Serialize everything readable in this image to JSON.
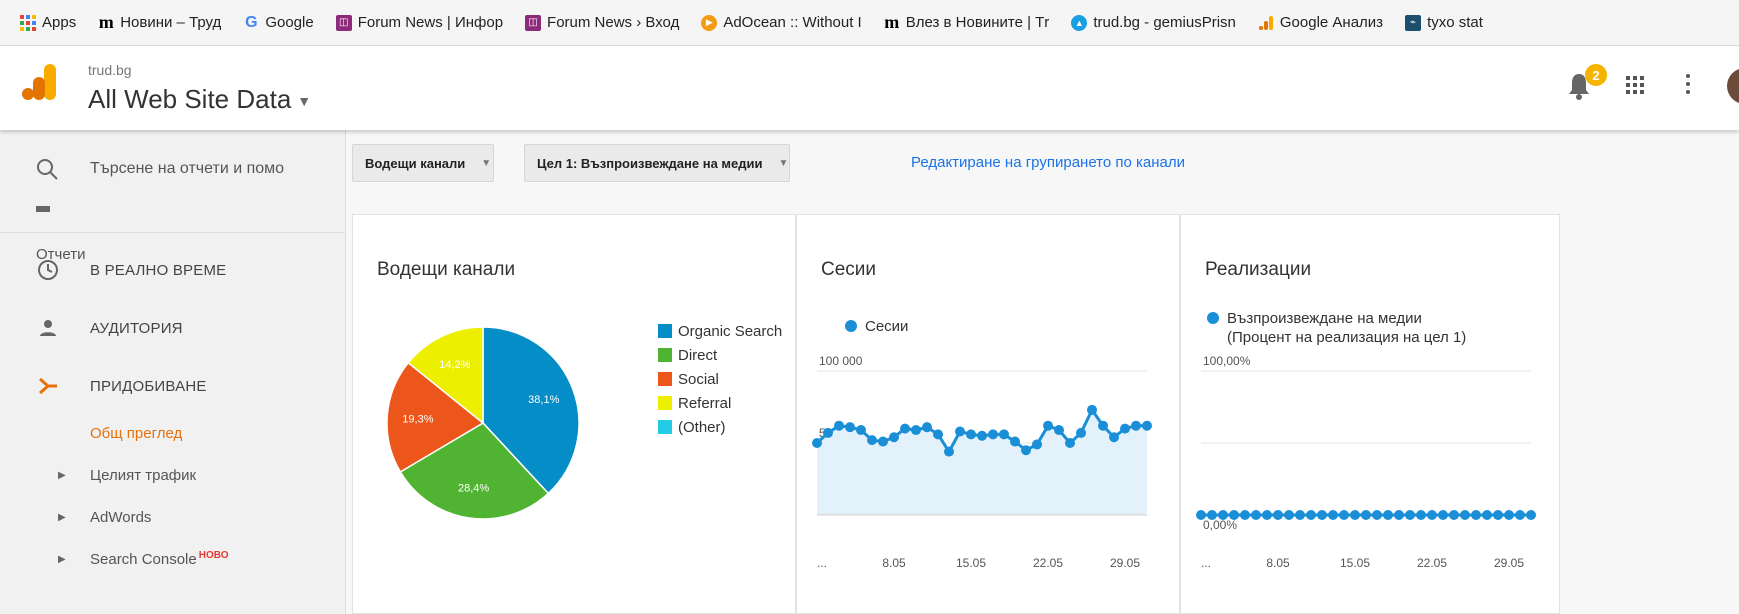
{
  "bookmarks": [
    {
      "label": "Apps",
      "icon": "apps-grid-icon"
    },
    {
      "label": "Новини – Труд",
      "icon": "m-logo-icon"
    },
    {
      "label": "Google",
      "icon": "google-icon"
    },
    {
      "label": "Forum News | Инфор",
      "icon": "forum-news-icon"
    },
    {
      "label": "Forum News › Вход",
      "icon": "forum-news-icon"
    },
    {
      "label": "AdOcean :: Without I",
      "icon": "adocean-icon"
    },
    {
      "label": "Влез в Новините | Тr",
      "icon": "m-logo-icon"
    },
    {
      "label": "trud.bg - gemiusPrisn",
      "icon": "trud-icon"
    },
    {
      "label": "Google Анализ",
      "icon": "google-analytics-icon"
    },
    {
      "label": "tyxo stat",
      "icon": "tyxo-icon"
    }
  ],
  "header": {
    "account": "trud.bg",
    "property": "All Web Site Data",
    "notifications_count": "2"
  },
  "sidebar": {
    "search_placeholder": "Търсене на отчети и помо",
    "reports_label": "Отчети",
    "items": [
      {
        "label": "В РЕАЛНО ВРЕМЕ",
        "icon": "clock-icon"
      },
      {
        "label": "АУДИТОРИЯ",
        "icon": "person-icon"
      },
      {
        "label": "ПРИДОБИВАНЕ",
        "icon": "acquisition-icon"
      }
    ],
    "subitems": [
      {
        "label": "Общ преглед",
        "active": true
      },
      {
        "label": "Целият трафик"
      },
      {
        "label": "AdWords"
      },
      {
        "label": "Search Console",
        "badge": "НОВО"
      }
    ]
  },
  "toolbar": {
    "dropdown1": "Водещи канали",
    "dropdown2": "Цел 1: Възпроизвеждане на медии",
    "edit_link": "Редактиране на групирането по канали"
  },
  "colors": {
    "accent": "#e8710a",
    "link": "#1a73e8",
    "series": "#1a8fd8"
  },
  "panels": {
    "channels": {
      "title": "Водещи канали"
    },
    "sessions": {
      "title": "Сесии",
      "legend": "Сесии"
    },
    "conversions": {
      "title": "Реализации",
      "legend_line1": "Възпроизвеждане на медии",
      "legend_line2": "(Процент на реализация на цел 1)"
    }
  },
  "chart_data": [
    {
      "type": "pie",
      "title": "Водещи канали",
      "slices": [
        {
          "name": "Organic Search",
          "value": 38.1,
          "label": "38,1%",
          "color": "#058dc7"
        },
        {
          "name": "Direct",
          "value": 28.4,
          "label": "28,4%",
          "color": "#50b432"
        },
        {
          "name": "Social",
          "value": 19.3,
          "label": "19,3%",
          "color": "#ed561b"
        },
        {
          "name": "Referral",
          "value": 14.2,
          "label": "14,2%",
          "color": "#edef00"
        },
        {
          "name": "(Other)",
          "value": 0,
          "label": "",
          "color": "#24cbe5"
        }
      ]
    },
    {
      "type": "area",
      "title": "Сесии",
      "series": [
        {
          "name": "Сесии",
          "values": [
            50000,
            57000,
            62000,
            61000,
            59000,
            52000,
            51000,
            54000,
            60000,
            59000,
            61000,
            56000,
            44000,
            58000,
            56000,
            55000,
            56000,
            56000,
            51000,
            45000,
            49000,
            62000,
            59000,
            50000,
            57000,
            73000,
            62000,
            54000,
            60000,
            62000,
            62000
          ]
        }
      ],
      "y_ticks": [
        "50 000",
        "100 000"
      ],
      "ylim": [
        0,
        100000
      ],
      "x_ticks": [
        "...",
        "8.05",
        "15.05",
        "22.05",
        "29.05"
      ]
    },
    {
      "type": "line",
      "title": "Реализации",
      "series": [
        {
          "name": "Възпроизвеждане на медии",
          "values": [
            0,
            0,
            0,
            0,
            0,
            0,
            0,
            0,
            0,
            0,
            0,
            0,
            0,
            0,
            0,
            0,
            0,
            0,
            0,
            0,
            0,
            0,
            0,
            0,
            0,
            0,
            0,
            0,
            0,
            0,
            0
          ]
        }
      ],
      "y_ticks": [
        "0,00%",
        "100,00%"
      ],
      "ylim": [
        0,
        100
      ],
      "x_ticks": [
        "...",
        "8.05",
        "15.05",
        "22.05",
        "29.05"
      ]
    }
  ]
}
